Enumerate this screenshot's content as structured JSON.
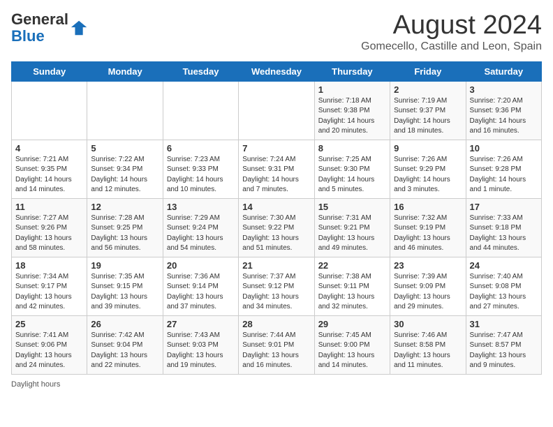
{
  "header": {
    "logo_line1": "General",
    "logo_line2": "Blue",
    "main_title": "August 2024",
    "subtitle": "Gomecello, Castille and Leon, Spain"
  },
  "calendar": {
    "days_of_week": [
      "Sunday",
      "Monday",
      "Tuesday",
      "Wednesday",
      "Thursday",
      "Friday",
      "Saturday"
    ],
    "weeks": [
      [
        {
          "day": "",
          "info": ""
        },
        {
          "day": "",
          "info": ""
        },
        {
          "day": "",
          "info": ""
        },
        {
          "day": "",
          "info": ""
        },
        {
          "day": "1",
          "info": "Sunrise: 7:18 AM\nSunset: 9:38 PM\nDaylight: 14 hours\nand 20 minutes."
        },
        {
          "day": "2",
          "info": "Sunrise: 7:19 AM\nSunset: 9:37 PM\nDaylight: 14 hours\nand 18 minutes."
        },
        {
          "day": "3",
          "info": "Sunrise: 7:20 AM\nSunset: 9:36 PM\nDaylight: 14 hours\nand 16 minutes."
        }
      ],
      [
        {
          "day": "4",
          "info": "Sunrise: 7:21 AM\nSunset: 9:35 PM\nDaylight: 14 hours\nand 14 minutes."
        },
        {
          "day": "5",
          "info": "Sunrise: 7:22 AM\nSunset: 9:34 PM\nDaylight: 14 hours\nand 12 minutes."
        },
        {
          "day": "6",
          "info": "Sunrise: 7:23 AM\nSunset: 9:33 PM\nDaylight: 14 hours\nand 10 minutes."
        },
        {
          "day": "7",
          "info": "Sunrise: 7:24 AM\nSunset: 9:31 PM\nDaylight: 14 hours\nand 7 minutes."
        },
        {
          "day": "8",
          "info": "Sunrise: 7:25 AM\nSunset: 9:30 PM\nDaylight: 14 hours\nand 5 minutes."
        },
        {
          "day": "9",
          "info": "Sunrise: 7:26 AM\nSunset: 9:29 PM\nDaylight: 14 hours\nand 3 minutes."
        },
        {
          "day": "10",
          "info": "Sunrise: 7:26 AM\nSunset: 9:28 PM\nDaylight: 14 hours\nand 1 minute."
        }
      ],
      [
        {
          "day": "11",
          "info": "Sunrise: 7:27 AM\nSunset: 9:26 PM\nDaylight: 13 hours\nand 58 minutes."
        },
        {
          "day": "12",
          "info": "Sunrise: 7:28 AM\nSunset: 9:25 PM\nDaylight: 13 hours\nand 56 minutes."
        },
        {
          "day": "13",
          "info": "Sunrise: 7:29 AM\nSunset: 9:24 PM\nDaylight: 13 hours\nand 54 minutes."
        },
        {
          "day": "14",
          "info": "Sunrise: 7:30 AM\nSunset: 9:22 PM\nDaylight: 13 hours\nand 51 minutes."
        },
        {
          "day": "15",
          "info": "Sunrise: 7:31 AM\nSunset: 9:21 PM\nDaylight: 13 hours\nand 49 minutes."
        },
        {
          "day": "16",
          "info": "Sunrise: 7:32 AM\nSunset: 9:19 PM\nDaylight: 13 hours\nand 46 minutes."
        },
        {
          "day": "17",
          "info": "Sunrise: 7:33 AM\nSunset: 9:18 PM\nDaylight: 13 hours\nand 44 minutes."
        }
      ],
      [
        {
          "day": "18",
          "info": "Sunrise: 7:34 AM\nSunset: 9:17 PM\nDaylight: 13 hours\nand 42 minutes."
        },
        {
          "day": "19",
          "info": "Sunrise: 7:35 AM\nSunset: 9:15 PM\nDaylight: 13 hours\nand 39 minutes."
        },
        {
          "day": "20",
          "info": "Sunrise: 7:36 AM\nSunset: 9:14 PM\nDaylight: 13 hours\nand 37 minutes."
        },
        {
          "day": "21",
          "info": "Sunrise: 7:37 AM\nSunset: 9:12 PM\nDaylight: 13 hours\nand 34 minutes."
        },
        {
          "day": "22",
          "info": "Sunrise: 7:38 AM\nSunset: 9:11 PM\nDaylight: 13 hours\nand 32 minutes."
        },
        {
          "day": "23",
          "info": "Sunrise: 7:39 AM\nSunset: 9:09 PM\nDaylight: 13 hours\nand 29 minutes."
        },
        {
          "day": "24",
          "info": "Sunrise: 7:40 AM\nSunset: 9:08 PM\nDaylight: 13 hours\nand 27 minutes."
        }
      ],
      [
        {
          "day": "25",
          "info": "Sunrise: 7:41 AM\nSunset: 9:06 PM\nDaylight: 13 hours\nand 24 minutes."
        },
        {
          "day": "26",
          "info": "Sunrise: 7:42 AM\nSunset: 9:04 PM\nDaylight: 13 hours\nand 22 minutes."
        },
        {
          "day": "27",
          "info": "Sunrise: 7:43 AM\nSunset: 9:03 PM\nDaylight: 13 hours\nand 19 minutes."
        },
        {
          "day": "28",
          "info": "Sunrise: 7:44 AM\nSunset: 9:01 PM\nDaylight: 13 hours\nand 16 minutes."
        },
        {
          "day": "29",
          "info": "Sunrise: 7:45 AM\nSunset: 9:00 PM\nDaylight: 13 hours\nand 14 minutes."
        },
        {
          "day": "30",
          "info": "Sunrise: 7:46 AM\nSunset: 8:58 PM\nDaylight: 13 hours\nand 11 minutes."
        },
        {
          "day": "31",
          "info": "Sunrise: 7:47 AM\nSunset: 8:57 PM\nDaylight: 13 hours\nand 9 minutes."
        }
      ]
    ]
  },
  "footer": {
    "daylight_label": "Daylight hours"
  }
}
